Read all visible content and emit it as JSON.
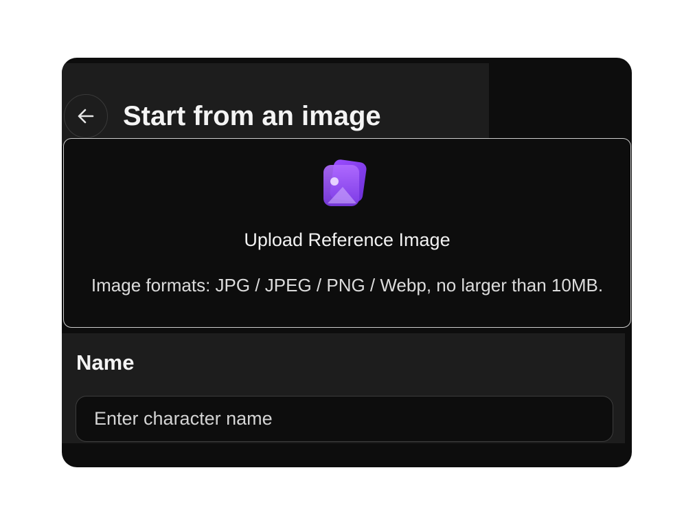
{
  "header": {
    "title": "Start from an image",
    "back_icon": "arrow-left-icon"
  },
  "upload": {
    "icon": "image-stack-icon",
    "title": "Upload Reference Image",
    "hint": "Image formats: JPG / JPEG / PNG / Webp, no larger than 10MB."
  },
  "form": {
    "name_label": "Name",
    "name_value": "",
    "name_placeholder": "Enter character name"
  },
  "colors": {
    "panel_background": "#0d0d0d",
    "band_background": "#1d1d1d",
    "accent_purple": "#8b45e8",
    "text_primary": "#f4f4f4"
  }
}
